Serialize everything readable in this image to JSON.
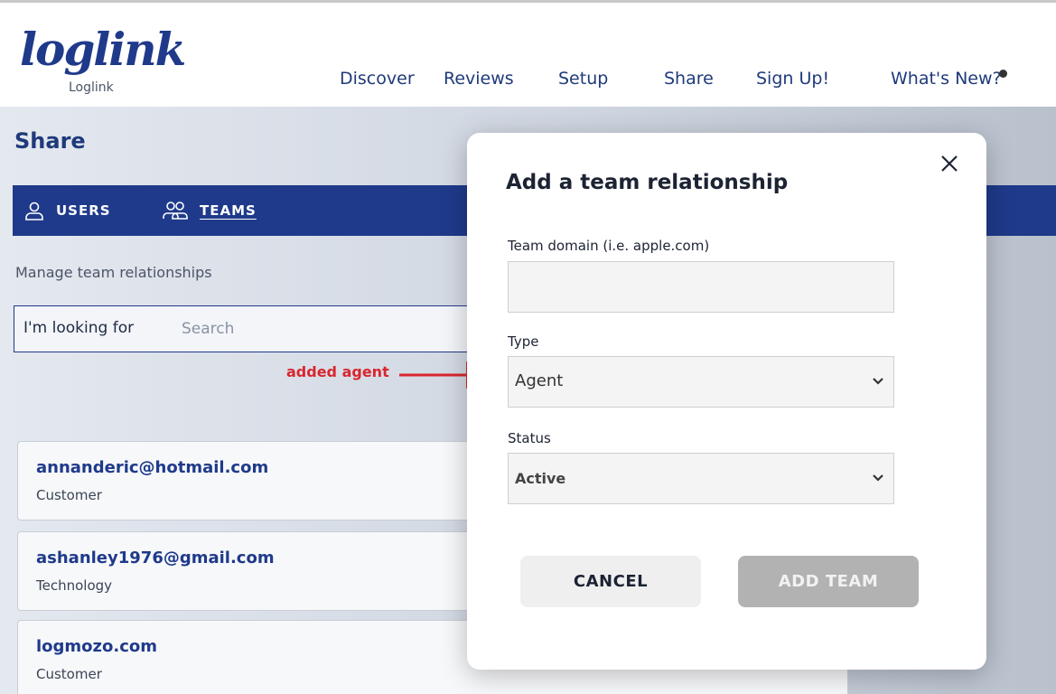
{
  "header": {
    "logo_text": "loglink",
    "logo_subtitle": "Loglink",
    "nav": [
      "Discover",
      "Reviews",
      "Setup",
      "Share",
      "Sign Up!",
      "What's New?"
    ]
  },
  "page": {
    "title": "Share",
    "tabs": {
      "users": "USERS",
      "teams": "TEAMS"
    },
    "manage_text": "Manage team relationships",
    "search_label": "I'm looking for",
    "search_placeholder": "Search",
    "cards": [
      {
        "title": "annanderic@hotmail.com",
        "subtitle": "Customer"
      },
      {
        "title": "ashanley1976@gmail.com",
        "subtitle": "Technology"
      },
      {
        "title": "logmozo.com",
        "subtitle": "Customer"
      }
    ]
  },
  "annotation": {
    "text": "added agent",
    "color": "#d9262e"
  },
  "modal": {
    "title": "Add a team relationship",
    "domain_label": "Team domain (i.e. apple.com)",
    "domain_value": "",
    "type_label": "Type",
    "type_value": "Agent",
    "status_label": "Status",
    "status_value": "Active",
    "cancel_label": "CANCEL",
    "add_label": "ADD TEAM"
  },
  "colors": {
    "brand": "#1f3a8a",
    "disabled_button": "#b2b2b2"
  }
}
